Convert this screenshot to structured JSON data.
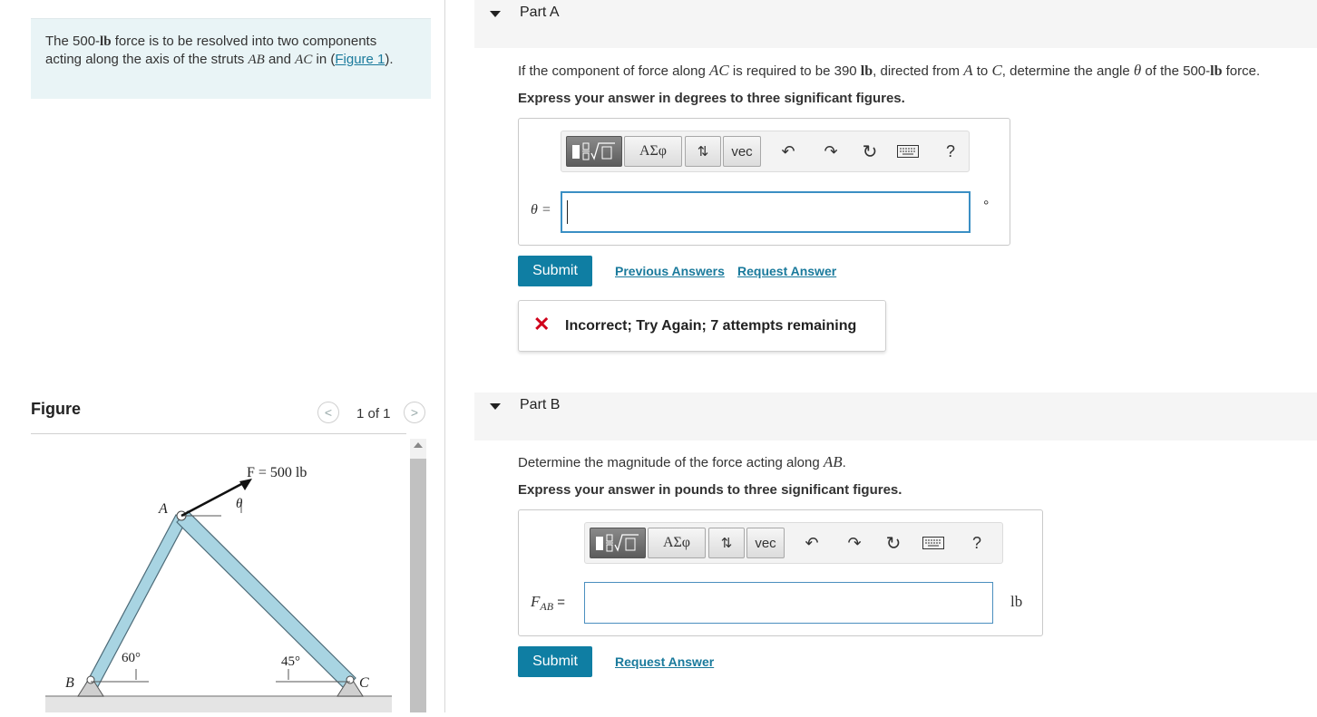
{
  "problem": {
    "text_1": "The 500-",
    "unit_lb": "lb",
    "text_2": " force is to be resolved into two components acting along the axis of the struts ",
    "strut_ab": "AB",
    "text_3": " and ",
    "strut_ac": "AC",
    "text_4": " in (",
    "figure_link": "Figure 1",
    "text_5": ")."
  },
  "figure": {
    "title": "Figure",
    "counter": "1 of 1",
    "prev_icon": "chevron-left-icon",
    "next_icon": "chevron-right-icon",
    "labels": {
      "force": "F = 500 lb",
      "theta": "θ",
      "point_a": "A",
      "point_b": "B",
      "point_c": "C",
      "angle_b": "60°",
      "angle_c": "45°"
    }
  },
  "toolbar": {
    "btn_templates_icon": "fraction-sqrt-icon",
    "btn_greek": "ΑΣφ",
    "btn_arrows": "⇅",
    "btn_vec": "vec",
    "undo_icon": "undo-icon",
    "redo_icon": "redo-icon",
    "reset_icon": "reset-icon",
    "keyboard_icon": "keyboard-icon",
    "help": "?"
  },
  "part_a": {
    "title": "Part A",
    "q_1": "If the component of force along ",
    "q_ac": "AC",
    "q_2": " is required to be 390 ",
    "q_lb": "lb",
    "q_3": ", directed from ",
    "q_a": "A",
    "q_4": " to ",
    "q_c": "C",
    "q_5": ", determine the angle ",
    "q_theta": "θ",
    "q_6": " of the 500-",
    "q_lb2": "lb",
    "q_7": " force.",
    "instruction": "Express your answer in degrees to three significant figures.",
    "var_label": "θ =",
    "input_value": "",
    "unit": "°",
    "submit": "Submit",
    "previous_answers": "Previous Answers",
    "request_answer": "Request Answer",
    "feedback": "Incorrect; Try Again; 7 attempts remaining",
    "feedback_icon": "x-mark-icon"
  },
  "part_b": {
    "title": "Part B",
    "q_1": "Determine the magnitude of the force acting along ",
    "q_ab": "AB",
    "q_2": ".",
    "instruction": "Express your answer in pounds to three significant figures.",
    "var_main": "F",
    "var_sub": "AB",
    "var_eq": " =",
    "input_value": "",
    "unit": "lb",
    "submit": "Submit",
    "request_answer": "Request Answer"
  },
  "colors": {
    "accent": "#0f7ea3",
    "link": "#1a7a9c",
    "problem_bg": "#e9f4f6",
    "error": "#d0021b",
    "strut_fill": "#a8d4e2"
  }
}
